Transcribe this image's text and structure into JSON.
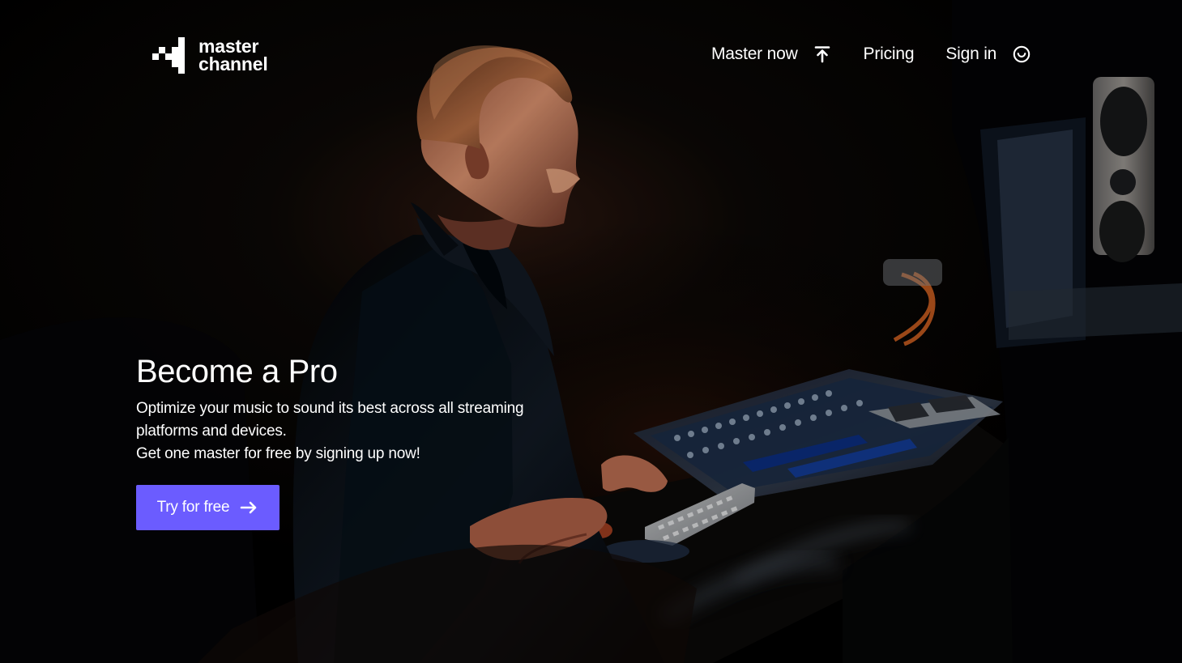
{
  "brand": {
    "line_1": "master",
    "line_2": "channel",
    "logo_icon": "stepped-squares-logo-icon"
  },
  "navigation": {
    "items": [
      {
        "label": "Master now",
        "icon": "upload-arrow-icon"
      },
      {
        "label": "Pricing"
      },
      {
        "label": "Sign in",
        "icon": "smile-user-icon"
      }
    ]
  },
  "hero": {
    "title": "Become a Pro",
    "description_lines": [
      "Optimize your music to sound its best across all streaming",
      "platforms and devices.",
      "Get one master for free by signing up now!"
    ],
    "button_label": "Try for free",
    "button_icon": "arrow-right-icon",
    "image": {
      "description": "Producer seated at a music mixing console with keyboard, studio monitor and dark studio lighting"
    }
  },
  "colors": {
    "page_background": "#000000",
    "text": "#ffffff",
    "accent": "#6b5cff"
  }
}
